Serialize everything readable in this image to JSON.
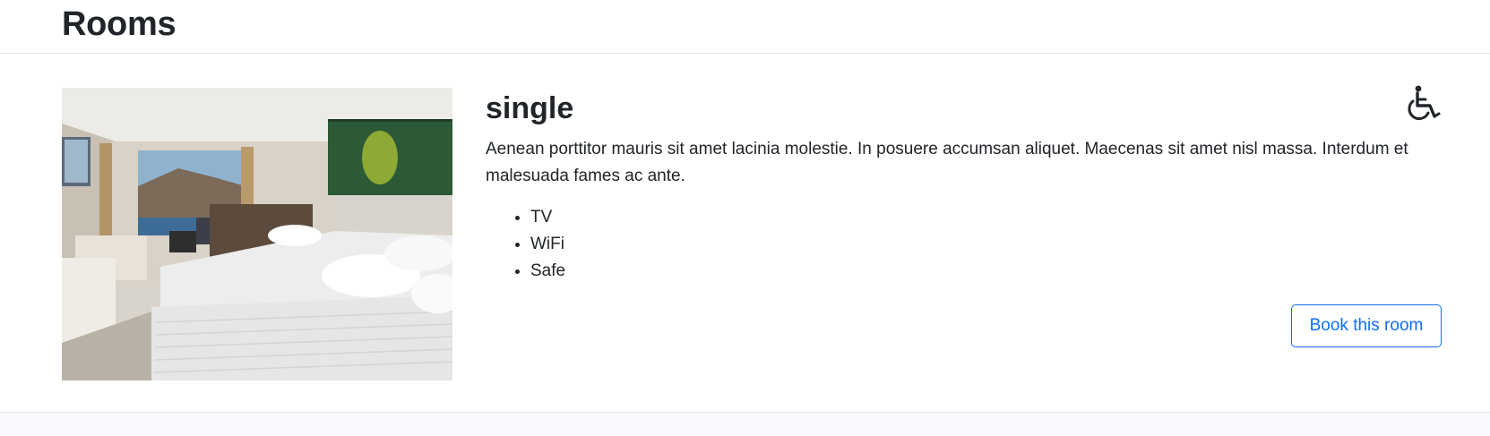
{
  "header": {
    "title": "Rooms"
  },
  "room": {
    "name": "single",
    "description": "Aenean porttitor mauris sit amet lacinia molestie. In posuere accumsan aliquet. Maecenas sit amet nisl massa. Interdum et malesuada fames ac ante.",
    "amenities": [
      "TV",
      "WiFi",
      "Safe"
    ],
    "accessible_icon": "wheelchair-icon",
    "book_label": "Book this room"
  },
  "colors": {
    "accent": "#0d6efd",
    "text": "#212529",
    "border": "#dee2e6"
  }
}
